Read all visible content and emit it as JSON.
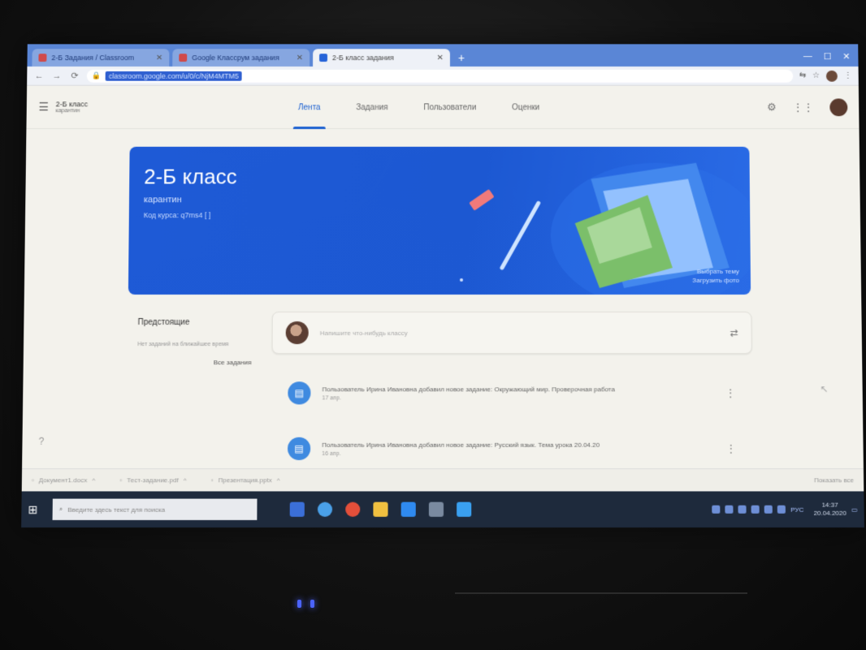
{
  "browser": {
    "tabs": [
      {
        "label": "2-Б Задания / Classroom",
        "active": false
      },
      {
        "label": "Google Классрум задания",
        "active": false
      },
      {
        "label": "2-Б класс задания",
        "active": true
      }
    ],
    "new_tab": "+",
    "url": "classroom.google.com/u/0/c/NjM4MTM5"
  },
  "header": {
    "class_name": "2-Б класс",
    "class_sub": "карантин",
    "tabs": [
      {
        "label": "Лента",
        "active": true
      },
      {
        "label": "Задания",
        "active": false
      },
      {
        "label": "Пользователи",
        "active": false
      },
      {
        "label": "Оценки",
        "active": false
      }
    ]
  },
  "banner": {
    "title": "2-Б класс",
    "subtitle": "карантин",
    "code_label": "Код курса: q7ms4 [ ]",
    "photo_action": "Выбрать тему\nЗагрузить фото"
  },
  "sidebar": {
    "title": "Предстоящие",
    "text": "Нет заданий на ближайшее время",
    "link": "Все задания"
  },
  "composer": {
    "placeholder": "Напишите что-нибудь классу"
  },
  "posts": [
    {
      "text": "Пользователь Ирина Ивановна добавил новое задание: Окружающий мир. Проверочная работа",
      "date": "17 апр."
    },
    {
      "text": "Пользователь Ирина Ивановна добавил новое задание: Русский язык. Тема урока 20.04.20",
      "date": "16 апр."
    }
  ],
  "downloads": [
    {
      "label": "Документ1.docx"
    },
    {
      "label": "Тест-задание.pdf"
    },
    {
      "label": "Презентация.pptx"
    }
  ],
  "downloads_show_all": "Показать все",
  "taskbar": {
    "search_placeholder": "Введите здесь текст для поиска",
    "time": "14:37",
    "date": "20.04.2020",
    "lang": "РУС"
  },
  "colors": {
    "banner": "#1e5ad6",
    "accent": "#1a5fd0",
    "chrome": "#5a86d6",
    "taskbar": "#1e2a3c"
  }
}
